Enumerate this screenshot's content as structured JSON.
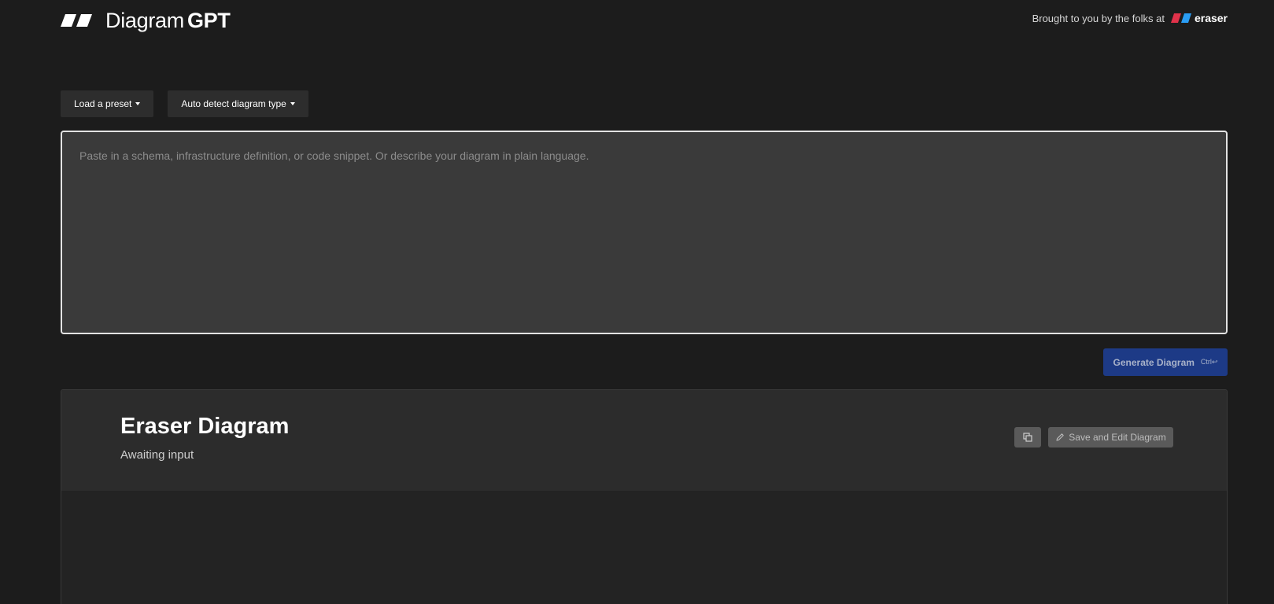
{
  "header": {
    "logo_icon": "eraser-parallelogram-logo",
    "logo_text_light": "Diagram",
    "logo_text_bold": "GPT",
    "credit_text": "Brought to you by the folks at",
    "credit_brand": "eraser",
    "credit_brand_colors": [
      "#e0324a",
      "#2a9df4"
    ]
  },
  "toolbar": {
    "preset_label": "Load a preset",
    "diagram_type_label": "Auto detect diagram type"
  },
  "prompt": {
    "value": "",
    "placeholder": "Paste in a schema, infrastructure definition, or code snippet. Or describe your diagram in plain language."
  },
  "generate": {
    "label": "Generate Diagram",
    "shortcut": "Ctrl↩",
    "color": "#1d3a86"
  },
  "output": {
    "title": "Eraser Diagram",
    "status": "Awaiting input",
    "copy_icon": "copy-icon",
    "edit_label": "Save and Edit Diagram",
    "edit_icon": "pencil-icon"
  }
}
